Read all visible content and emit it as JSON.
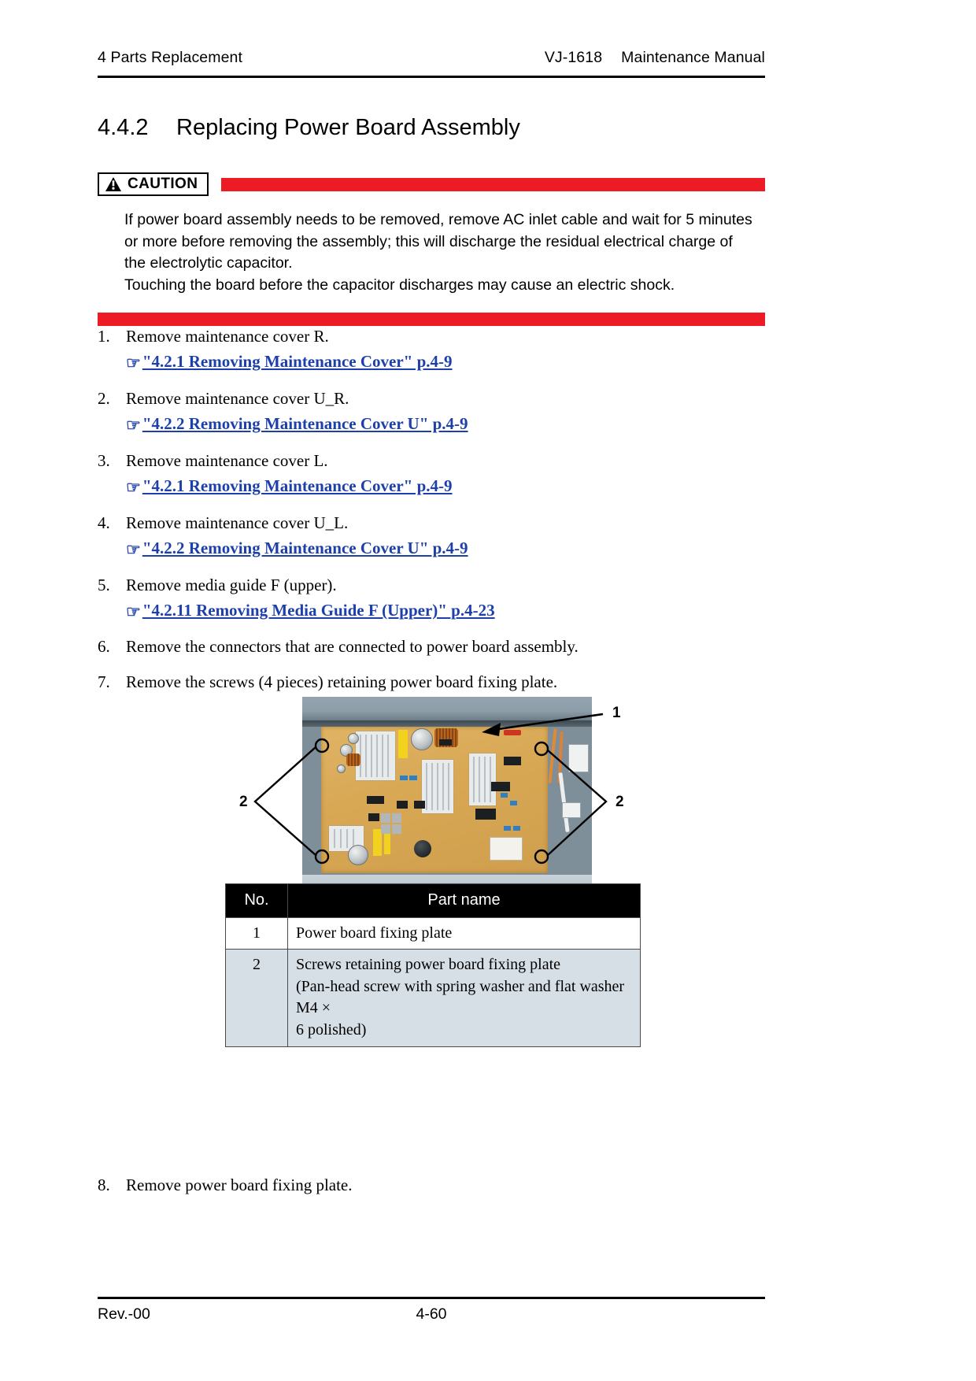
{
  "header": {
    "left": "4 Parts Replacement",
    "model": "VJ-1618",
    "doc_type": "Maintenance Manual"
  },
  "section": {
    "number": "4.4.2",
    "title": "Replacing Power Board Assembly"
  },
  "caution": {
    "label": "CAUTION",
    "line1": "If power board assembly needs to be removed, remove AC inlet cable and wait for 5 minutes",
    "line2": "or more before removing the assembly; this will discharge the residual electrical charge of",
    "line3": "the electrolytic capacitor.",
    "line4": "Touching the board before the capacitor discharges may cause an electric shock.",
    "bar_color": "#ed1c24"
  },
  "steps": [
    {
      "num": "1.",
      "text": "Remove maintenance cover R.",
      "ref": "\"4.2.1 Removing Maintenance Cover\" p.4-9"
    },
    {
      "num": "2.",
      "text": "Remove maintenance cover U_R.",
      "ref": "\"4.2.2 Removing Maintenance Cover U\" p.4-9"
    },
    {
      "num": "3.",
      "text": "Remove maintenance cover L.",
      "ref": "\"4.2.1 Removing Maintenance Cover\" p.4-9"
    },
    {
      "num": "4.",
      "text": "Remove maintenance cover U_L.",
      "ref": "\"4.2.2 Removing Maintenance Cover U\" p.4-9"
    },
    {
      "num": "5.",
      "text": "Remove media guide F (upper).",
      "ref": "\"4.2.11 Removing Media Guide F (Upper)\" p.4-23"
    },
    {
      "num": "6.",
      "text": "Remove the connectors that are connected to power board assembly.",
      "ref": ""
    },
    {
      "num": "7.",
      "text": "Remove the screws (4 pieces) retaining power board fixing plate.",
      "ref": ""
    }
  ],
  "figure": {
    "callouts": [
      {
        "id": "callout-1",
        "label": "1"
      },
      {
        "id": "callout-2-left",
        "label": "2"
      },
      {
        "id": "callout-2-right",
        "label": "2"
      }
    ],
    "link_color": "#1c3faa"
  },
  "parts_table": {
    "columns": [
      "No.",
      "Part name"
    ],
    "rows": [
      {
        "no": "1",
        "name_lines": [
          "Power board fixing plate"
        ]
      },
      {
        "no": "2",
        "name_lines": [
          "Screws retaining power board fixing plate",
          "(Pan-head screw with spring washer and flat washer M4 ×",
          "6 polished)"
        ]
      }
    ]
  },
  "trailing_step": {
    "num": "8.",
    "text": "Remove power board fixing plate."
  },
  "footer": {
    "revision": "Rev.-00",
    "page": "4-60"
  }
}
